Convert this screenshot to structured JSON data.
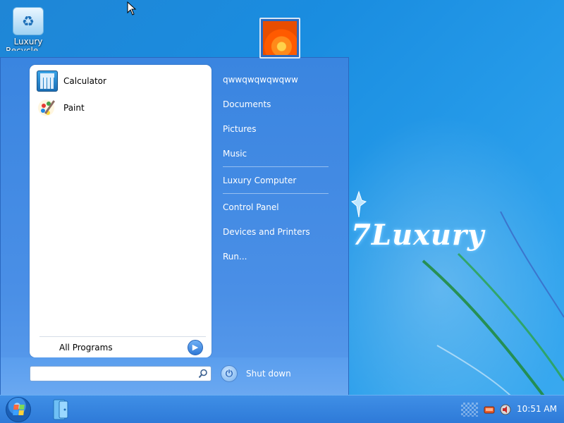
{
  "desktop": {
    "recycle_bin_label": "Luxury",
    "recycle_bin_label2": "Recycle Bin",
    "brand_text": "7Luxury"
  },
  "start_menu": {
    "programs": [
      {
        "label": "Calculator",
        "icon": "calculator-icon"
      },
      {
        "label": "Paint",
        "icon": "paint-icon"
      }
    ],
    "all_programs_label": "All Programs",
    "right_items": [
      {
        "label": "qwwqwqwqwqww",
        "name": "user-folder-link"
      },
      {
        "label": "Documents",
        "name": "documents-link"
      },
      {
        "label": "Pictures",
        "name": "pictures-link"
      },
      {
        "label": "Music",
        "name": "music-link"
      },
      {
        "label": "Luxury Computer",
        "name": "computer-link"
      },
      {
        "label": "Control Panel",
        "name": "control-panel-link"
      },
      {
        "label": "Devices and Printers",
        "name": "devices-printers-link"
      },
      {
        "label": "Run...",
        "name": "run-link"
      }
    ],
    "search": {
      "value": "",
      "placeholder": ""
    },
    "shutdown_label": "Shut down"
  },
  "taskbar": {
    "clock": "10:51 AM"
  },
  "colors": {
    "accent": "#3a85e0",
    "taskbar": "#2e7ad8"
  }
}
